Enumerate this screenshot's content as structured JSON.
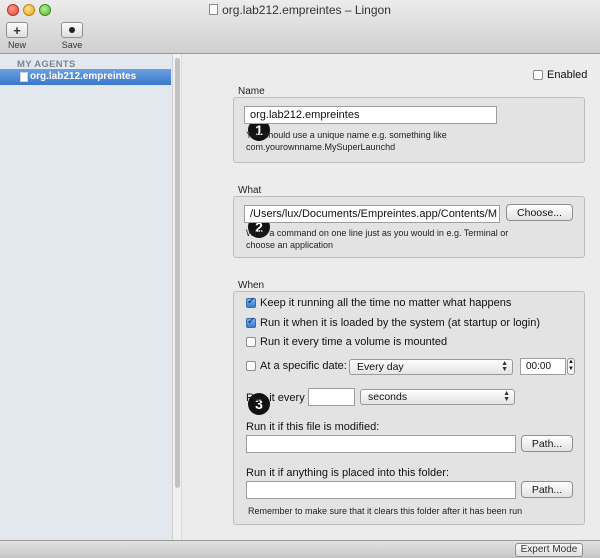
{
  "window": {
    "title": "org.lab212.empreintes – Lingon"
  },
  "toolbar": {
    "new_label": "New",
    "new_icon": "+",
    "save_label": "Save"
  },
  "sidebar": {
    "header": "MY AGENTS",
    "items": [
      {
        "label": "org.lab212.empreintes"
      }
    ]
  },
  "main": {
    "enabled_label": "Enabled",
    "name": {
      "section_label": "Name",
      "badge": "1",
      "value": "org.lab212.empreintes",
      "hint_line1": "You should use a unique name e.g. something like",
      "hint_line2": "com.yourownname.MySuperLaunchd"
    },
    "what": {
      "section_label": "What",
      "badge": "2",
      "value": "/Users/lux/Documents/Empreintes.app/Contents/M",
      "choose_button": "Choose...",
      "hint_line1": "Write a command on one line just as you would in e.g. Terminal or",
      "hint_line2": "choose an application"
    },
    "when": {
      "section_label": "When",
      "badge": "3",
      "keep_running": "Keep it running all the time no matter what happens",
      "run_at_load": "Run it when it is loaded by the system (at startup or login)",
      "run_on_mount": "Run it every time a volume is mounted",
      "specific_date_label": "At a specific date:",
      "date_option": "Every day",
      "time_value": "00:00",
      "run_every_label": "Run it every",
      "run_every_value": "",
      "interval_unit": "seconds",
      "file_modified_label": "Run it if this file is modified:",
      "file_modified_value": "",
      "path_button": "Path...",
      "folder_label": "Run it if anything is placed into this folder:",
      "folder_value": "",
      "folder_path_button": "Path...",
      "folder_hint": "Remember to make sure that it clears this folder after it has been run"
    }
  },
  "footer": {
    "expert_mode_button": "Expert Mode"
  }
}
